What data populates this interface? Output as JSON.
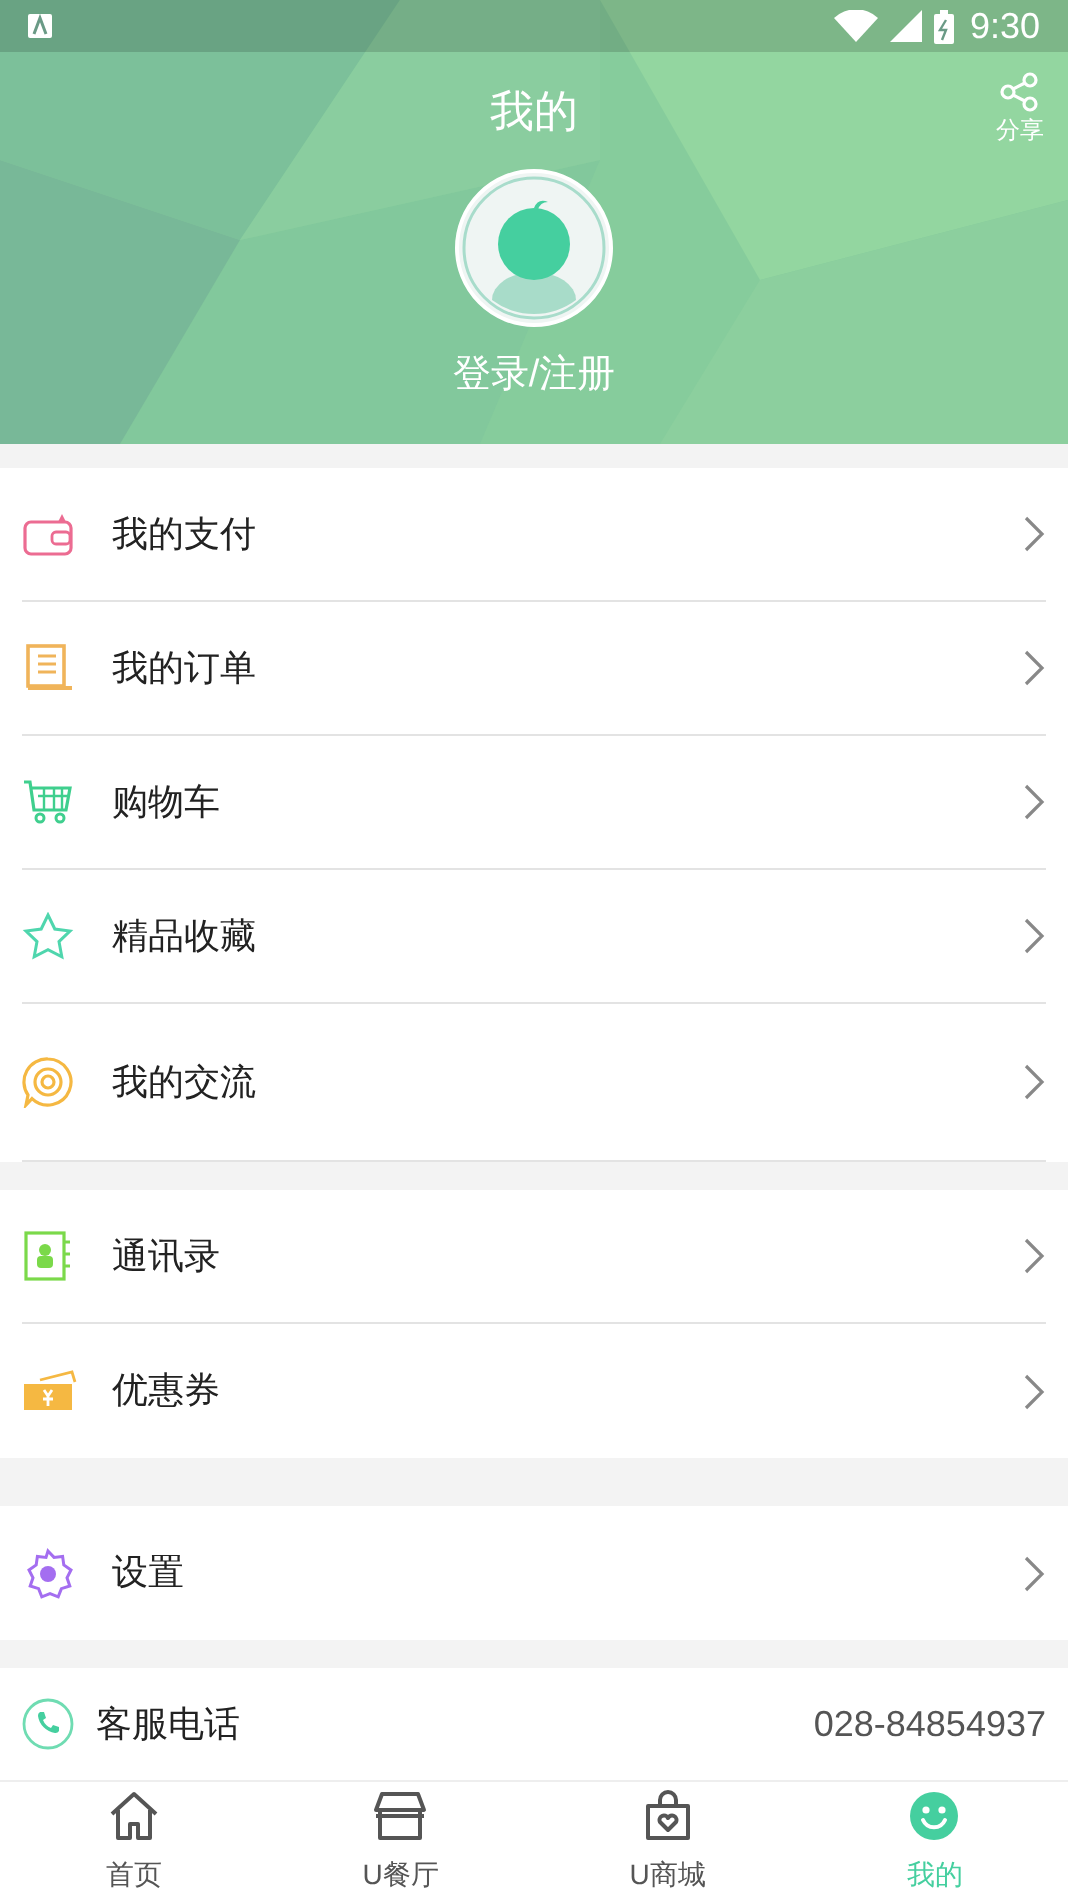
{
  "status_bar": {
    "time": "9:30"
  },
  "header": {
    "title": "我的",
    "share_label": "分享",
    "login_label": "登录/注册"
  },
  "menu_groups": [
    [
      {
        "label": "我的支付"
      },
      {
        "label": "我的订单"
      },
      {
        "label": "购物车"
      },
      {
        "label": "精品收藏"
      },
      {
        "label": "我的交流"
      }
    ],
    [
      {
        "label": "通讯录"
      },
      {
        "label": "优惠券"
      }
    ],
    [
      {
        "label": "设置"
      }
    ]
  ],
  "service": {
    "label": "客服电话",
    "phone": "028-84854937"
  },
  "tab_bar": [
    {
      "label": "首页",
      "selected": false
    },
    {
      "label": "U餐厅",
      "selected": false
    },
    {
      "label": "U商城",
      "selected": false
    },
    {
      "label": "我的",
      "selected": true
    }
  ]
}
